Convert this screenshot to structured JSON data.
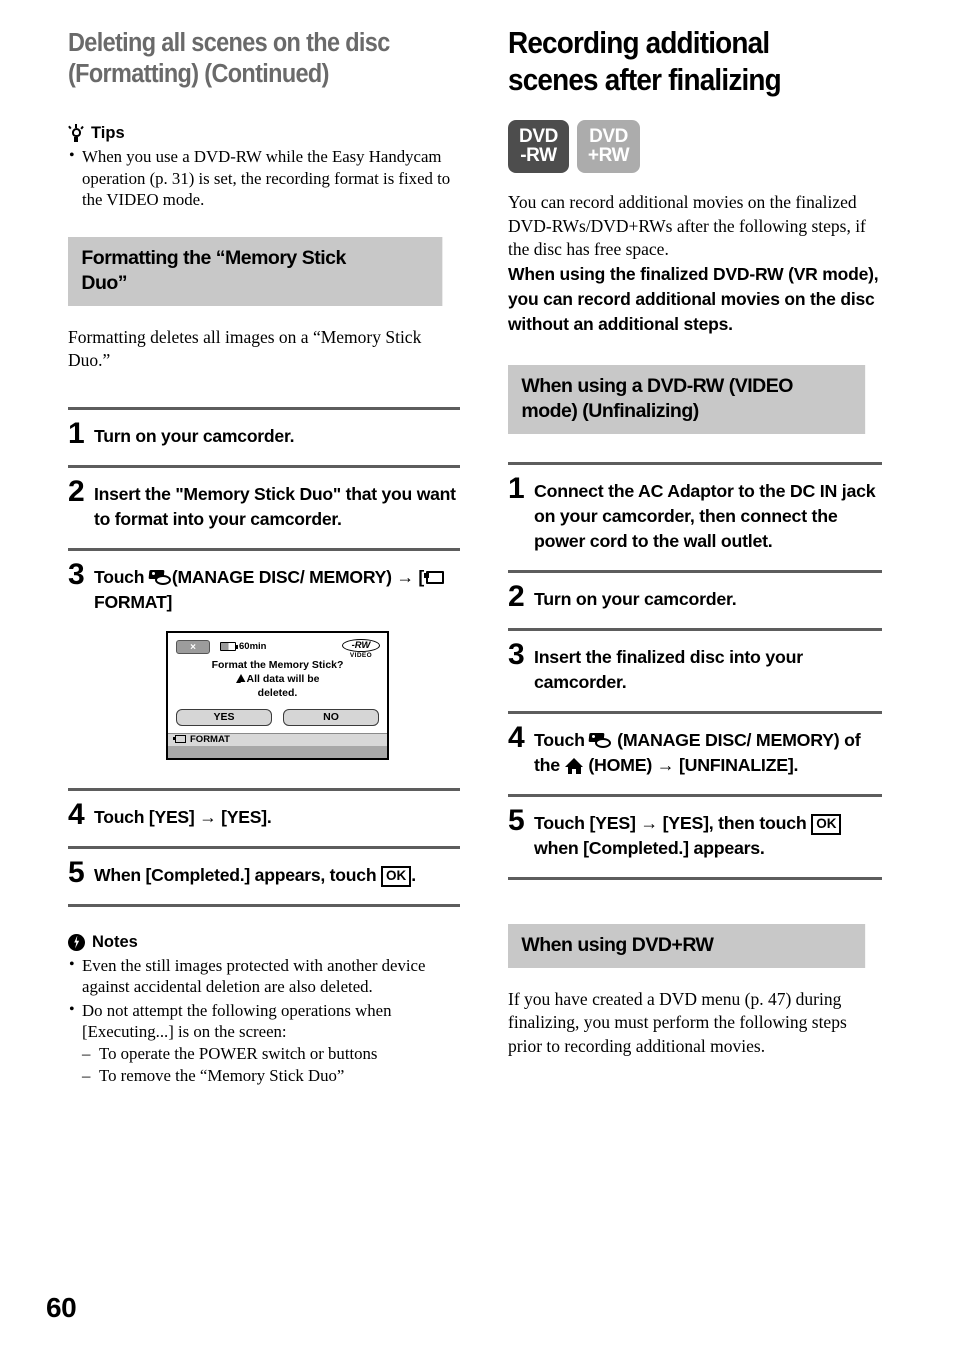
{
  "page": {
    "number": "60"
  },
  "left": {
    "chapter_title_line1": "Deleting all scenes on the disc",
    "chapter_title_line2": "(Formatting) (Continued)",
    "tips": {
      "label": "Tips",
      "items": [
        "When you use a DVD-RW while the Easy Handycam operation (p. 31) is set, the recording format is fixed to the VIDEO mode."
      ]
    },
    "section_band_line1": "Formatting the “Memory Stick",
    "section_band_line2": "Duo”",
    "intro": "Formatting deletes all images on a “Memory Stick Duo.”",
    "steps": [
      {
        "num": "1",
        "text": "Turn on your camcorder."
      },
      {
        "num": "2",
        "text": "Insert the \"Memory Stick Duo\" that you want to format into your camcorder."
      },
      {
        "num": "3",
        "text_a": "Touch",
        "text_b": "(MANAGE DISC/ MEMORY)",
        "arrow": "→",
        "text_c": "[",
        "text_d": "FORMAT]"
      },
      {
        "num": "4",
        "text_a": "Touch [YES]",
        "arrow": "→",
        "text_b": "[YES]."
      },
      {
        "num": "5",
        "text_a": "When [Completed.] appears, touch",
        "ok": "OK",
        "text_b": "."
      }
    ],
    "lcd": {
      "close_label": "×",
      "battery_time": "60min",
      "disc_label": "-RW",
      "disc_sub": "VIDEO",
      "message_line1": "Format the Memory Stick?",
      "message_line2": "All data will be",
      "message_line3": "deleted.",
      "button_yes": "YES",
      "button_no": "NO",
      "status_bar": "FORMAT"
    },
    "notes": {
      "label": "Notes",
      "items": [
        "Even the still images protected with another device against accidental deletion are also deleted.",
        "Do not attempt the following operations when [Executing...] is on the screen:"
      ],
      "subitems": [
        "To operate the POWER switch or buttons",
        "To remove the “Memory Stick Duo”"
      ]
    }
  },
  "right": {
    "section_title_line1": "Recording additional",
    "section_title_line2": "scenes after finalizing",
    "badges": [
      {
        "line1": "DVD",
        "line2": "-RW",
        "color": "#4d4d4d"
      },
      {
        "line1": "DVD",
        "line2": "+RW",
        "color": "#acacac"
      }
    ],
    "intro_serif": "You can record additional movies on the finalized DVD-RWs/DVD+RWs after the following steps, if the disc has free space.",
    "intro_bold": "When using the finalized DVD-RW (VR mode), you can record additional movies on the disc without an additional steps.",
    "band1_line1": "When using a DVD-RW (VIDEO",
    "band1_line2": "mode) (Unfinalizing)",
    "steps": [
      {
        "num": "1",
        "text": "Connect the AC Adaptor to the DC IN jack on your camcorder, then connect the power cord to the wall outlet."
      },
      {
        "num": "2",
        "text": "Turn on your camcorder."
      },
      {
        "num": "3",
        "text": "Insert the finalized disc into your camcorder."
      },
      {
        "num": "4",
        "text_a": "Touch",
        "text_b": "(MANAGE DISC/ MEMORY) of the",
        "text_c": "(HOME)",
        "arrow": "→",
        "text_d": "[UNFINALIZE]."
      },
      {
        "num": "5",
        "text_a": "Touch [YES]",
        "arrow": "→",
        "text_b": "[YES], then touch",
        "ok": "OK",
        "text_c": "when [Completed.] appears."
      }
    ],
    "band2": "When using DVD+RW",
    "outro": "If you have created a DVD menu (p. 47) during finalizing, you must perform the following steps prior to recording additional movies."
  }
}
